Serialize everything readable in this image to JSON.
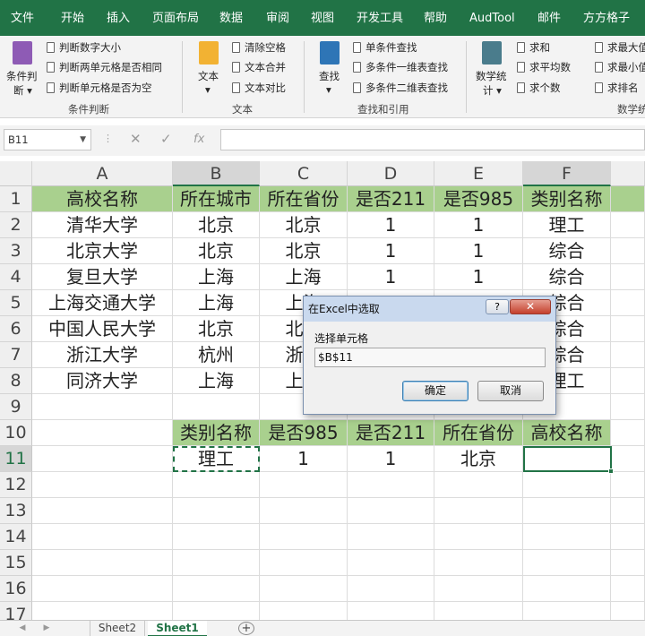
{
  "menu_tabs": [
    "文件",
    "开始",
    "插入",
    "页面布局",
    "数据",
    "审阅",
    "视图",
    "开发工具",
    "帮助",
    "AudTool",
    "邮件",
    "方方格子"
  ],
  "ribbon": {
    "cond": {
      "big_label_1": "条件判",
      "big_label_2": "断 ▾",
      "items": [
        "判断数字大小",
        "判断两单元格是否相同",
        "判断单元格是否为空"
      ],
      "group": "条件判断"
    },
    "text": {
      "big_label_1": "文本",
      "big_label_2": "▾",
      "items": [
        "清除空格",
        "文本合并",
        "文本对比"
      ],
      "group": "文本"
    },
    "lookup": {
      "big_label_1": "查找",
      "big_label_2": "▾",
      "items": [
        "单条件查找",
        "多条件一维表查找",
        "多条件二维表查找"
      ],
      "group": "查找和引用"
    },
    "stats": {
      "big_label_1": "数学统",
      "big_label_2": "计 ▾",
      "items": [
        "求和",
        "求平均数",
        "求个数"
      ],
      "items2": [
        "求最大值",
        "求最小值",
        "求排名"
      ],
      "group": "数学统"
    }
  },
  "formula_bar": {
    "name_box": "B11",
    "formula": ""
  },
  "columns": [
    "A",
    "B",
    "C",
    "D",
    "E",
    "F"
  ],
  "rows": [
    [
      "高校名称",
      "所在城市",
      "所在省份",
      "是否211",
      "是否985",
      "类别名称"
    ],
    [
      "清华大学",
      "北京",
      "北京",
      "1",
      "1",
      "理工"
    ],
    [
      "北京大学",
      "北京",
      "北京",
      "1",
      "1",
      "综合"
    ],
    [
      "复旦大学",
      "上海",
      "上海",
      "1",
      "1",
      "综合"
    ],
    [
      "上海交通大学",
      "上海",
      "上海",
      "",
      "",
      "综合"
    ],
    [
      "中国人民大学",
      "北京",
      "北京",
      "",
      "",
      "综合"
    ],
    [
      "浙江大学",
      "杭州",
      "浙江",
      "",
      "",
      "综合"
    ],
    [
      "同济大学",
      "上海",
      "上海",
      "",
      "",
      "理工"
    ],
    [
      "",
      "",
      "",
      "",
      "",
      ""
    ],
    [
      "",
      "类别名称",
      "是否985",
      "是否211",
      "所在省份",
      "高校名称"
    ],
    [
      "",
      "理工",
      "1",
      "1",
      "北京",
      ""
    ],
    [
      "",
      "",
      "",
      "",
      "",
      ""
    ],
    [
      "",
      "",
      "",
      "",
      "",
      ""
    ],
    [
      "",
      "",
      "",
      "",
      "",
      ""
    ],
    [
      "",
      "",
      "",
      "",
      "",
      ""
    ],
    [
      "",
      "",
      "",
      "",
      "",
      ""
    ],
    [
      "",
      "",
      "",
      "",
      "",
      ""
    ]
  ],
  "row_numbers": [
    "1",
    "2",
    "3",
    "4",
    "5",
    "6",
    "7",
    "8",
    "9",
    "10",
    "11",
    "12",
    "13",
    "14",
    "15",
    "16",
    "17"
  ],
  "dialog": {
    "title": "在Excel中选取",
    "help": "?",
    "label": "选择单元格",
    "value": "$B$11",
    "ok": "确定",
    "cancel": "取消"
  },
  "sheets": [
    "Sheet2",
    "Sheet1"
  ],
  "add_sheet": "+",
  "colors": {
    "accent": "#217346",
    "header_fill": "#a9d08e"
  }
}
